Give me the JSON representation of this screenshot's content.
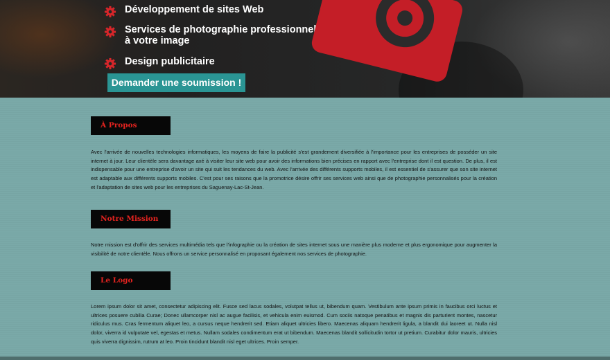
{
  "hero": {
    "services": [
      "Développement de sites Web",
      "Services de photographie professionnel\nà votre image",
      "Design publicitaire"
    ],
    "cta_label": "Demander une soumission !"
  },
  "sections": [
    {
      "title": "À Propos",
      "text": "Avec l'arrivée de nouvelles technologies informatiques, les moyens de faire la publicité s'est grandement diversifiée à l'importance pour les entreprises de posséder un site internet à jour. Leur clientèle sera davantage axé à visiter leur site web pour avoir des informations bien précises en rapport avec l'entreprise dont il est question. De plus, il est indispensable pour une entreprise d'avoir un site qui suit les tendances du web. Avec l'arrivée des différents supports mobiles, il est essentiel de s'assurer que son site internet est adaptable aux différents supports mobiles. C'est pour ses raisons que la promotrice désire offrir ses services web ainsi que de photographie personnalisés pour la création et l'adaptation de sites web pour les entreprises du Saguenay-Lac-St-Jean."
    },
    {
      "title": "Notre Mission",
      "text": "Notre mission est d'offrir des services multimédia tels que l'infographie ou la création de sites internet sous une manière plus moderne et plus ergonomique pour augmenter la visibilité de notre clientèle. Nous offrons un service personnalisé en proposant également nos services de photographie."
    },
    {
      "title": "Le Logo",
      "text": "Lorem ipsum dolor sit amet, consectetur adipiscing elit. Fusce sed lacus sodales, volutpat tellus ut, bibendum quam. Vestibulum ante ipsum primis in faucibus orci luctus et ultrices posuere cubilia Curae; Donec ullamcorper nisl ac augue facilisis, et vehicula enim euismod. Cum sociis natoque penatibus et magnis dis parturient montes, nascetur ridiculus mus. Cras fermentum aliquet leo, a cursus neque hendrerit sed. Etiam aliquet ultricies libero. Maecenas aliquam hendrerit ligula, a blandit dui laoreet ut. Nulla nisl dolor, viverra id vulputate vel, egestas et metus. Nullam sodales condimentum erat ut bibendum. Maecenas blandit sollicitudin tortor ut pretium. Curabitur dolor mauris, ultricies quis viverra dignissim, rutrum at leo. Proin tincidunt blandit nisl eget ultrices. Proin semper."
    }
  ],
  "colors": {
    "accent_red": "#e3231f",
    "cta_teal": "#2a9594",
    "camera_red": "#c41e27",
    "content_bg": "#7aa9a8"
  },
  "icons": {
    "service_bullet": "gear-icon",
    "illustration": "camera-icon"
  }
}
